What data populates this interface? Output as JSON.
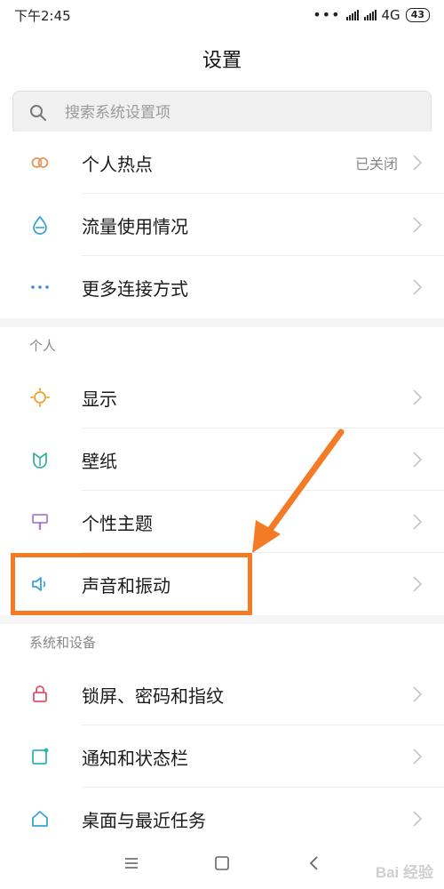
{
  "status_bar": {
    "time": "下午2:45",
    "network": "4G",
    "battery": "43"
  },
  "header": {
    "title": "设置"
  },
  "search": {
    "placeholder": "搜索系统设置项"
  },
  "rows": [
    {
      "label": "个人热点",
      "value": "已关闭",
      "icon": "hotspot-icon",
      "color": "#e8945a"
    },
    {
      "label": "流量使用情况",
      "value": "",
      "icon": "data-usage-icon",
      "color": "#3aa3d8"
    },
    {
      "label": "更多连接方式",
      "value": "",
      "icon": "more-connections-icon",
      "color": "#3b8de0"
    },
    {
      "label": "显示",
      "value": "",
      "icon": "display-icon",
      "color": "#f0a030"
    },
    {
      "label": "壁纸",
      "value": "",
      "icon": "wallpaper-icon",
      "color": "#3cb39a"
    },
    {
      "label": "个性主题",
      "value": "",
      "icon": "theme-icon",
      "color": "#b07ad0"
    },
    {
      "label": "声音和振动",
      "value": "",
      "icon": "sound-icon",
      "color": "#3aa3d8"
    },
    {
      "label": "锁屏、密码和指纹",
      "value": "",
      "icon": "lock-icon",
      "color": "#e0506a"
    },
    {
      "label": "通知和状态栏",
      "value": "",
      "icon": "notification-icon",
      "color": "#2fb3c0"
    },
    {
      "label": "桌面与最近任务",
      "value": "",
      "icon": "home-icon",
      "color": "#3aa3d8"
    }
  ],
  "sections": {
    "personal": "个人",
    "system": "系统和设备"
  },
  "watermark": "Bai 经验",
  "colors": {
    "annotation": "#f37b26"
  }
}
